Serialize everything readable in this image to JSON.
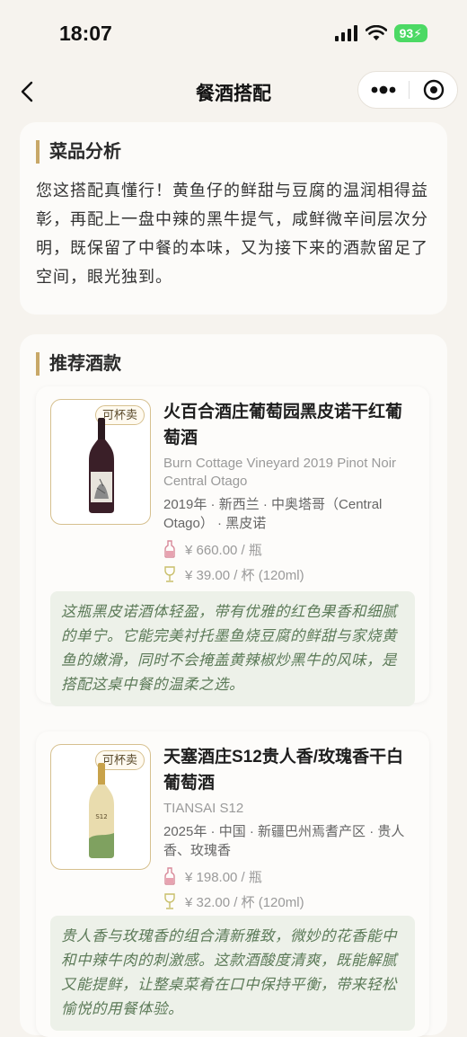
{
  "status": {
    "time": "18:07",
    "battery": "93"
  },
  "nav": {
    "title": "餐酒搭配"
  },
  "analysis": {
    "heading": "菜品分析",
    "text": "您这搭配真懂行！黄鱼仔的鲜甜与豆腐的温润相得益彰，再配上一盘中辣的黑牛提气，咸鲜微辛间层次分明，既保留了中餐的本味，又为接下来的酒款留足了空间，眼光独到。"
  },
  "recommend": {
    "heading": "推荐酒款",
    "wines": [
      {
        "badge": "可杯卖",
        "name": "火百合酒庄葡萄园黑皮诺干红葡萄酒",
        "name_en": "Burn Cottage Vineyard 2019 Pinot Noir Central Otago",
        "meta": "2019年 · 新西兰 · 中奥塔哥（Central Otago） · 黑皮诺",
        "bottle_price": "¥ 660.00 / 瓶",
        "glass_price": "¥ 39.00 / 杯 (120ml)",
        "note": "这瓶黑皮诺酒体轻盈，带有优雅的红色果香和细腻的单宁。它能完美衬托墨鱼烧豆腐的鲜甜与家烧黄鱼的嫩滑，同时不会掩盖黄辣椒炒黑牛的风味，是搭配这桌中餐的温柔之选。"
      },
      {
        "badge": "可杯卖",
        "name": "天塞酒庄S12贵人香/玫瑰香干白葡萄酒",
        "name_en": "TIANSAI S12",
        "meta": "2025年 · 中国 · 新疆巴州焉耆产区 · 贵人香、玫瑰香",
        "bottle_price": "¥ 198.00 / 瓶",
        "glass_price": "¥ 32.00 / 杯 (120ml)",
        "note": "贵人香与玫瑰香的组合清新雅致，微妙的花香能中和中辣牛肉的刺激感。这款酒酸度清爽，既能解腻又能提鲜，让整桌菜肴在口中保持平衡，带来轻松愉悦的用餐体验。"
      }
    ]
  },
  "colors": {
    "accent": "#c8a868",
    "note_bg": "#edf1e9",
    "note_text": "#5c7a58",
    "page_bg": "#f6f3ee"
  }
}
